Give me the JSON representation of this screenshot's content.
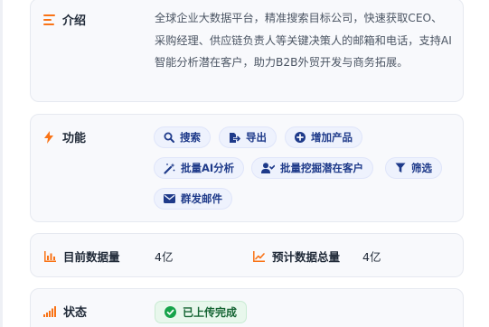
{
  "intro": {
    "label": "介绍",
    "text": "全球企业大数据平台，精准搜索目标公司，快速获取CEO、采购经理、供应链负责人等关键决策人的邮箱和电话，支持AI智能分析潜在客户，助力B2B外贸开发与商务拓展。"
  },
  "features": {
    "label": "功能",
    "chips": [
      {
        "label": "搜索",
        "icon": "search-icon"
      },
      {
        "label": "导出",
        "icon": "export-icon"
      },
      {
        "label": "增加产品",
        "icon": "plus-circle-icon"
      },
      {
        "label": "批量AI分析",
        "icon": "magic-wand-icon"
      },
      {
        "label": "批量挖掘潜在客户",
        "icon": "user-check-icon"
      },
      {
        "label": "筛选",
        "icon": "filter-icon"
      },
      {
        "label": "群发邮件",
        "icon": "envelope-icon"
      }
    ]
  },
  "stats": {
    "current": {
      "label": "目前数据量",
      "value": "4亿",
      "icon": "bar-chart-icon"
    },
    "expected": {
      "label": "预计数据总量",
      "value": "4亿",
      "icon": "line-chart-icon"
    }
  },
  "status": {
    "label": "状态",
    "badge": "已上传完成",
    "icon": "signal-bars-icon",
    "badge_icon": "check-circle-icon"
  },
  "colors": {
    "accent_orange": "#f97316",
    "chip_text": "#1e3a8a",
    "chip_bg": "#eef2fd",
    "success": "#16a34a"
  }
}
